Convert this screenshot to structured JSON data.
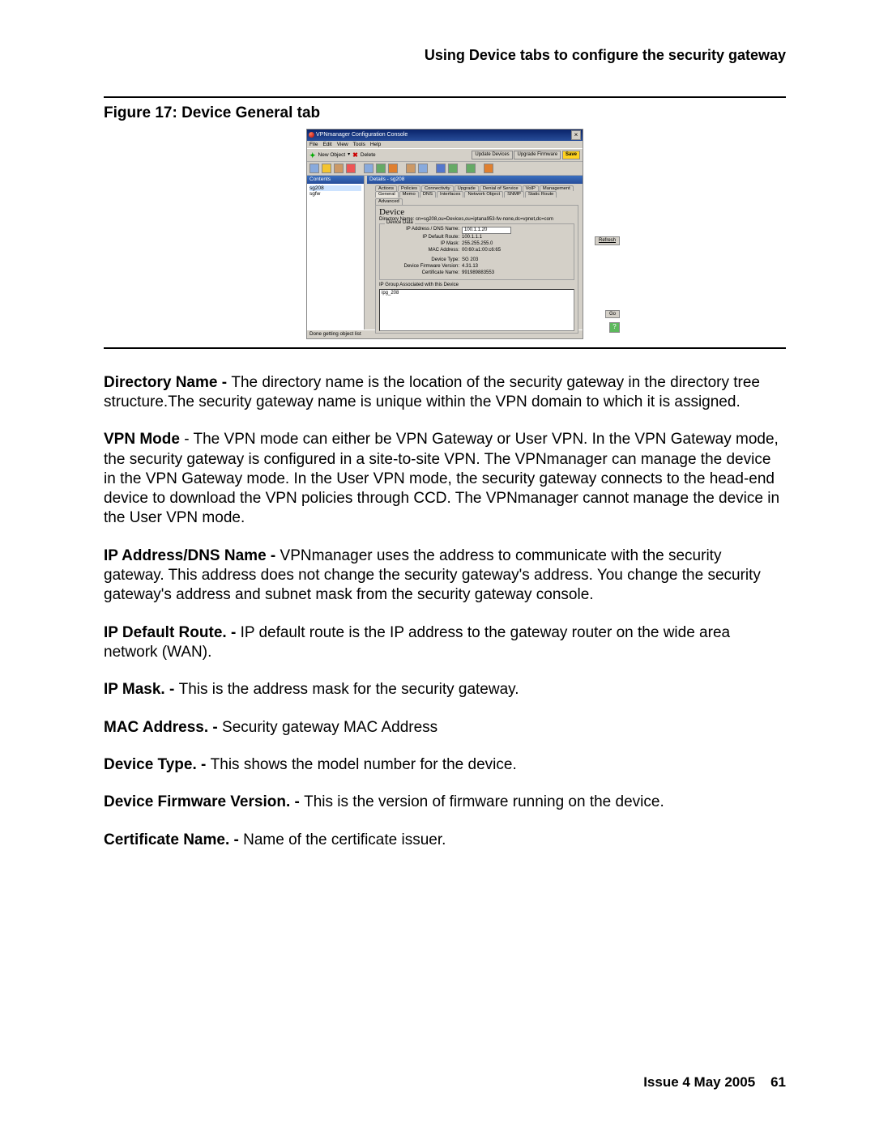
{
  "header": "Using Device tabs to configure the security gateway",
  "fig_caption": "Figure 17: Device General tab",
  "screenshot": {
    "title": "VPNmanager Configuration Console",
    "menubar": [
      "File",
      "Edit",
      "View",
      "Tools",
      "Help"
    ],
    "bigbar": {
      "new_object": "New Object",
      "delete": "Delete",
      "update": "Update Devices",
      "upgrade": "Upgrade Firmware",
      "save": "Save"
    },
    "sidebar": {
      "header": "Contents",
      "items": [
        "sg208",
        "sgfw"
      ]
    },
    "right_header": "Details - sg208",
    "tabs_row1": [
      "Actions",
      "Policies",
      "Connectivity",
      "Upgrade",
      "Denial of Service",
      "VoIP",
      "Management"
    ],
    "tabs_row2": [
      "General",
      "Memo",
      "DNS",
      "Interfaces",
      "Network Object",
      "SNMP",
      "Static Route",
      "Advanced"
    ],
    "panel": {
      "heading": "Device",
      "dir_label": "Directory Name:",
      "dir_value": "cn=sg208,ou=Devices,ou=iptana953-fw-none,dc=vpnet,dc=com",
      "device_data_legend": "Device Data",
      "fields": {
        "ip_label": "IP Address / DNS Name:",
        "ip_value": "100.1.1.20",
        "route_label": "IP Default Route:",
        "route_value": "100.1.1.1",
        "mask_label": "IP Mask:",
        "mask_value": "255.255.255.0",
        "mac_label": "MAC Address:",
        "mac_value": "00:60:a1:00:c6:65",
        "type_label": "Device Type:",
        "type_value": "SG 203",
        "fw_label": "Device Firmware Version:",
        "fw_value": "4.31.13",
        "cert_label": "Certificate Name:",
        "cert_value": "991989883553"
      },
      "group_legend": "IP Group Associated with this Device",
      "group_item": "ipg_208",
      "refresh": "Refresh",
      "go": "Go",
      "status": "Done getting object list"
    }
  },
  "paragraphs": {
    "p1_b": "Directory Name - ",
    "p1": "The directory name is the location of the security gateway in the directory tree structure.The security gateway name is unique within the VPN domain to which it is assigned.",
    "p2_b": "VPN Mode ",
    "p2": " - The VPN mode can either be VPN Gateway or User VPN. In the VPN Gateway mode, the security gateway is configured in a site-to-site VPN. The VPNmanager can manage the device in the VPN Gateway mode. In the User VPN mode, the security gateway connects to the head-end device to download the VPN policies through CCD. The VPNmanager cannot manage the device in the User VPN mode.",
    "p3_b": "IP Address/DNS Name - ",
    "p3": "VPNmanager uses the address to communicate with the security gateway. This address does not change the security gateway's address. You change the security gateway's address and subnet mask from the security gateway console.",
    "p4_b": "IP Default Route. - ",
    "p4": "IP default route is the IP address to the gateway router on the wide area network (WAN).",
    "p5_b": "IP Mask. - ",
    "p5": "This is the address mask for the security gateway.",
    "p6_b": "MAC Address. - ",
    "p6": "Security gateway MAC Address",
    "p7_b": "Device Type. - ",
    "p7": "This shows the model number for the device.",
    "p8_b": "Device Firmware Version. - ",
    "p8": "This is the version of firmware running on the device.",
    "p9_b": "Certificate Name. - ",
    "p9": "Name of the certificate issuer."
  },
  "footer": {
    "issue": "Issue 4   May 2005",
    "page": "61"
  }
}
